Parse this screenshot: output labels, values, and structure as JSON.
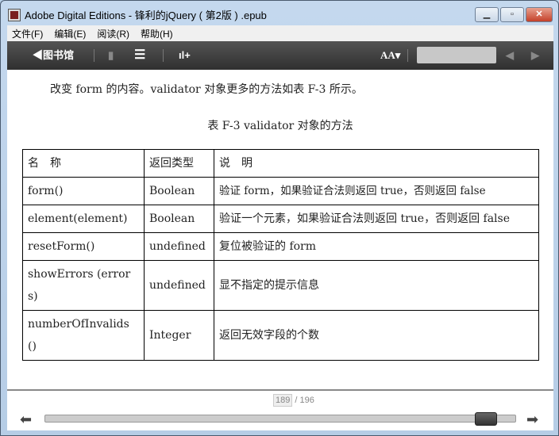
{
  "window": {
    "title": "Adobe Digital Editions - 锋利的jQuery ( 第2版 ) .epub"
  },
  "menu": [
    "文件(F)",
    "编辑(E)",
    "阅读(R)",
    "帮助(H)"
  ],
  "toolbar": {
    "library": "◀图书馆",
    "font_size": "AA▾",
    "search_placeholder": ""
  },
  "content": {
    "paragraph": "改变 form 的内容。validator 对象更多的方法如表 F-3 所示。",
    "caption": "表 F-3  validator 对象的方法",
    "table": {
      "headers": [
        "名　称",
        "返回类型",
        "说　明"
      ],
      "rows": [
        [
          "form()",
          "Boolean",
          "验证 form，如果验证合法则返回 true，否则返回 false"
        ],
        [
          "element(element)",
          "Boolean",
          "验证一个元素，如果验证合法则返回 true，否则返回 false"
        ],
        [
          "resetForm()",
          "undefined",
          "复位被验证的 form"
        ],
        [
          "showErrors (errors)",
          "undefined",
          "显不指定的提示信息"
        ],
        [
          "numberOfInvalids ()",
          "Integer",
          "返回无效字段的个数"
        ]
      ]
    }
  },
  "pagination": {
    "current": "189",
    "total": "/ 196",
    "progress": 0.96
  }
}
